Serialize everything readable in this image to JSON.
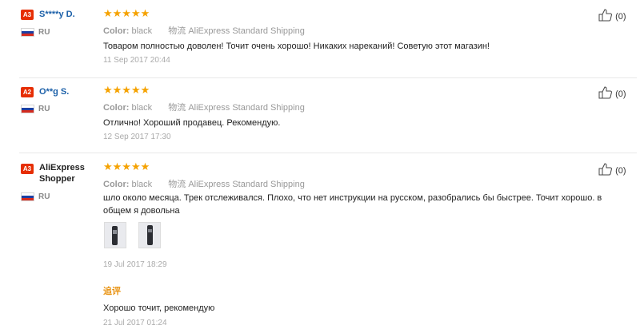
{
  "reviews": [
    {
      "badge": "A3",
      "name": "S****y D.",
      "country": "RU",
      "rating": "★★★★★",
      "color_label": "Color:",
      "color_value": "black",
      "shipping": "物流 AliExpress Standard Shipping",
      "text": "Товаром полностью доволен! Точит очень хорошо! Никаких нареканий! Советую этот магазин!",
      "date": "11 Sep 2017 20:44",
      "likes": "(0)"
    },
    {
      "badge": "A2",
      "name": "O**g S.",
      "country": "RU",
      "rating": "★★★★★",
      "color_label": "Color:",
      "color_value": "black",
      "shipping": "物流 AliExpress Standard Shipping",
      "text": "Отлично! Хороший продавец. Рекомендую.",
      "date": "12 Sep 2017 17:30",
      "likes": "(0)"
    },
    {
      "badge": "A3",
      "name": "AliExpress Shopper",
      "country": "RU",
      "rating": "★★★★★",
      "color_label": "Color:",
      "color_value": "black",
      "shipping": "物流 AliExpress Standard Shipping",
      "text": "шло около месяца. Трек отслеживался. Плохо, что нет инструкции на русском, разобрались бы быстрее. Точит хорошо. в общем я довольна",
      "date": "19 Jul 2017 18:29",
      "likes": "(0)",
      "additional_label": "追评",
      "additional_text": "Хорошо точит, рекомендую",
      "additional_date": "21 Jul 2017 01:24"
    }
  ],
  "colors": {
    "accent": "#e62e04",
    "star": "#f5a200",
    "link": "#1a5fa8"
  },
  "icons": {
    "like": "thumbs-up-icon",
    "flag": "russia-flag-icon"
  }
}
